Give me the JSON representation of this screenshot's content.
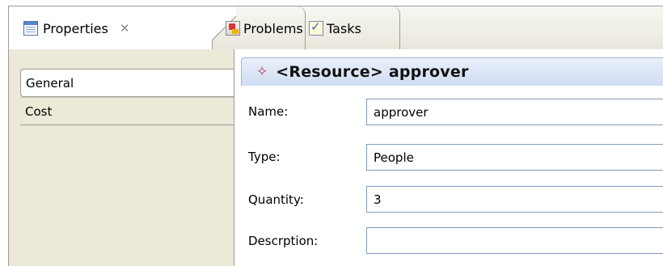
{
  "tabs": [
    {
      "label": "Properties",
      "icon": "properties-icon",
      "active": true,
      "closable": true
    },
    {
      "label": "Problems",
      "icon": "problems-icon",
      "active": false
    },
    {
      "label": "Tasks",
      "icon": "tasks-icon",
      "active": false
    }
  ],
  "close_glyph": "✕",
  "nav": {
    "items": [
      {
        "label": "General",
        "selected": true
      },
      {
        "label": "Cost",
        "selected": false
      }
    ]
  },
  "header": {
    "icon": "diamond-icon",
    "title": "<Resource> approver"
  },
  "form": {
    "name_label": "Name:",
    "name_value": "approver",
    "type_label": "Type:",
    "type_value": "People",
    "quantity_label": "Quantity:",
    "quantity_value": "3",
    "description_label": "Descrption:",
    "description_value": ""
  },
  "colors": {
    "header_accent": "#c03a58",
    "field_border": "#7f9db9",
    "panel_bg": "#ece9d8"
  }
}
